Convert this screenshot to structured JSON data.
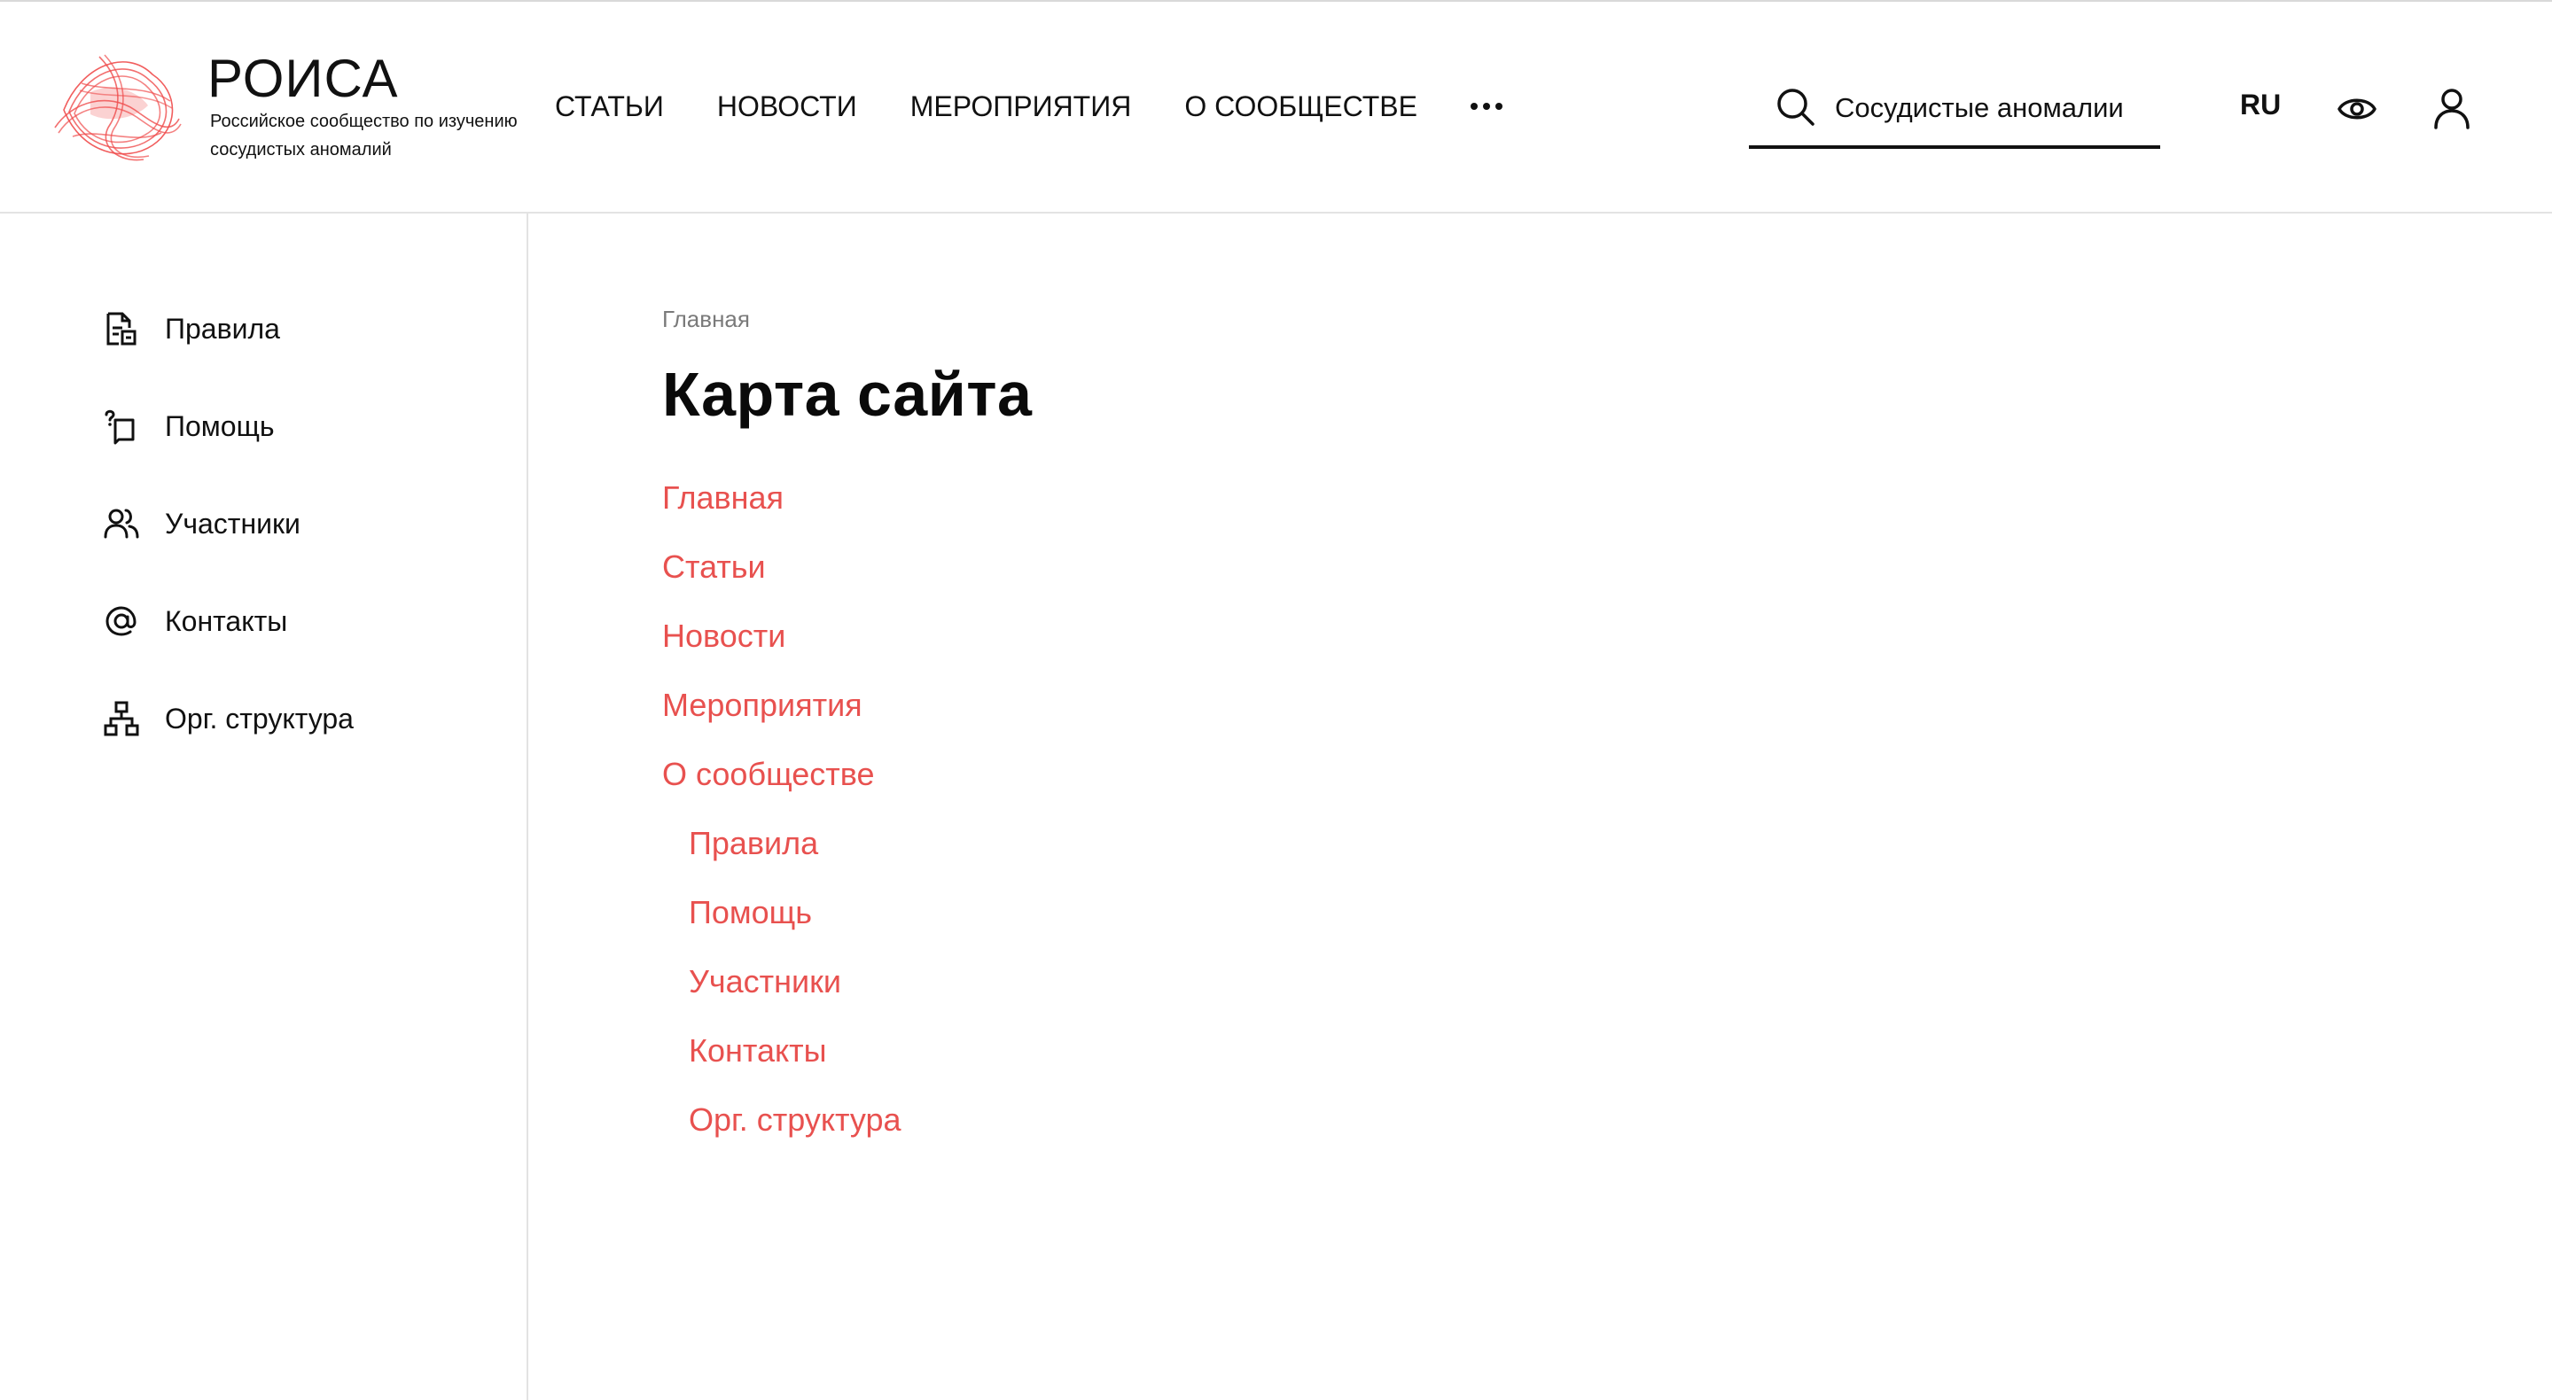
{
  "brand": {
    "title": "РОИСА",
    "subtitle": "Российское сообщество по изучению сосудистых аномалий",
    "accent": "#e8514f"
  },
  "nav": {
    "items": [
      {
        "label": "СТАТЬИ"
      },
      {
        "label": "НОВОСТИ"
      },
      {
        "label": "МЕРОПРИЯТИЯ"
      },
      {
        "label": "О СООБЩЕСТВЕ"
      }
    ],
    "more_icon": "more-dots-icon"
  },
  "search": {
    "value": "Сосудистые аномалии",
    "icon": "search-icon"
  },
  "header_actions": {
    "language": "RU",
    "accessibility_icon": "eye-icon",
    "profile_icon": "user-icon"
  },
  "sidebar": {
    "items": [
      {
        "label": "Правила",
        "icon": "rules-document-icon"
      },
      {
        "label": "Помощь",
        "icon": "help-icon"
      },
      {
        "label": "Участники",
        "icon": "members-icon"
      },
      {
        "label": "Контакты",
        "icon": "at-sign-icon"
      },
      {
        "label": "Орг. структура",
        "icon": "org-structure-icon"
      }
    ]
  },
  "main": {
    "breadcrumb": "Главная",
    "title": "Карта сайта",
    "sitemap": [
      {
        "label": "Главная"
      },
      {
        "label": "Статьи"
      },
      {
        "label": "Новости"
      },
      {
        "label": "Мероприятия"
      },
      {
        "label": "О сообществе"
      }
    ],
    "sitemap_sub": [
      {
        "label": "Правила"
      },
      {
        "label": "Помощь"
      },
      {
        "label": "Участники"
      },
      {
        "label": "Контакты"
      },
      {
        "label": "Орг. структура"
      }
    ]
  }
}
